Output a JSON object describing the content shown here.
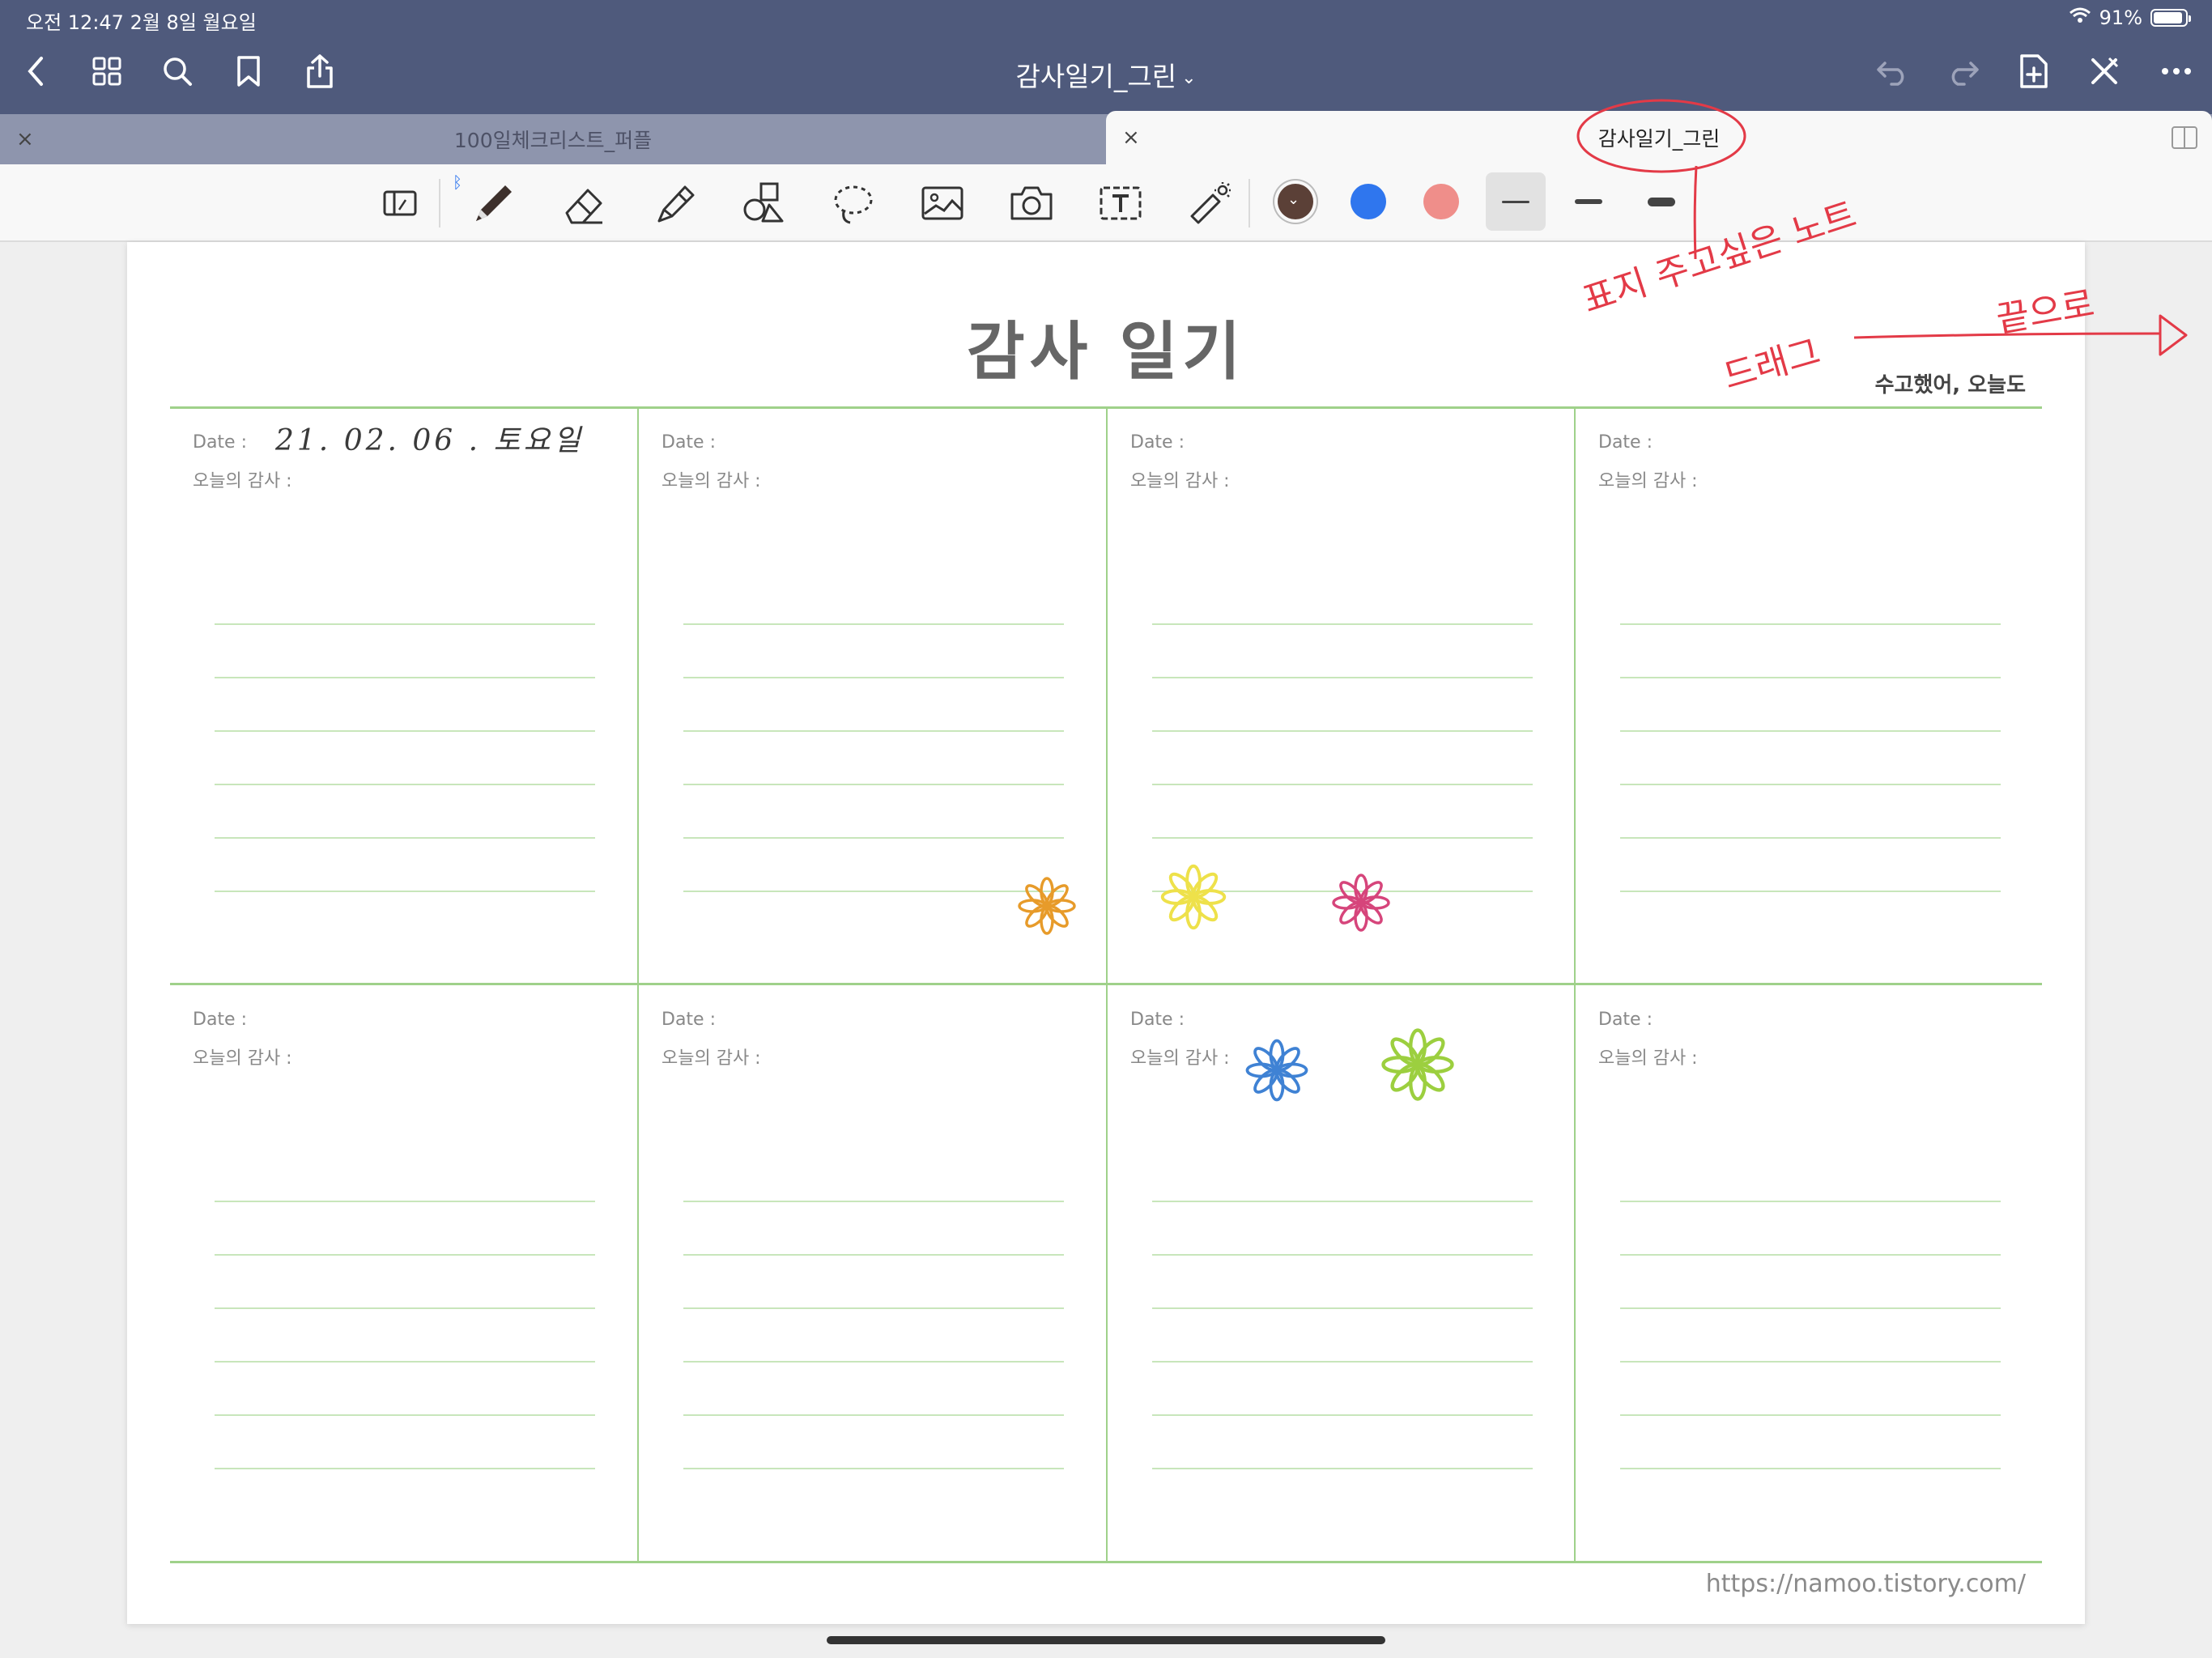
{
  "status": {
    "time": "오전 12:47   2월 8일 월요일",
    "battery": "91%",
    "battery_fraction": 0.91
  },
  "nav": {
    "title": "감사일기_그린",
    "icons": [
      "back-icon",
      "grid-icon",
      "search-icon",
      "bookmark-icon",
      "share-icon",
      "undo-icon",
      "redo-icon",
      "add-page-icon",
      "close-pen-icon",
      "more-icon"
    ]
  },
  "tabs": [
    {
      "label": "100일체크리스트_퍼플",
      "active": false
    },
    {
      "label": "감사일기_그린",
      "active": true
    }
  ],
  "toolbar": {
    "tools": [
      "read-mode-icon",
      "pen-icon",
      "eraser-icon",
      "highlighter-icon",
      "shapes-icon",
      "lasso-icon",
      "image-icon",
      "camera-icon",
      "text-icon",
      "laser-icon"
    ],
    "selected_tool": "pen-icon",
    "colors": [
      "#5b4037",
      "#2f76ee",
      "#ef8e8a"
    ],
    "selected_color": "#5b4037",
    "stroke_widths": [
      "thin",
      "medium",
      "thick"
    ],
    "selected_stroke": "thin"
  },
  "paper": {
    "title": "감사 일기",
    "subtitle": "수고했어, 오늘도",
    "url": "https://namoo.tistory.com/",
    "date_label": "Date :",
    "gratitude_label": "오늘의 감사 :",
    "handwriting": "21. 02. 06 . 토요일",
    "flower_colors": [
      "#e79b2a",
      "#eee14a",
      "#d6457b",
      "#3f82d4",
      "#9ccf3f"
    ]
  },
  "annotation": {
    "line1": "표지 주고싶은 노트",
    "line2": "드래그",
    "line3": "끝으로",
    "color": "#e33a47"
  }
}
